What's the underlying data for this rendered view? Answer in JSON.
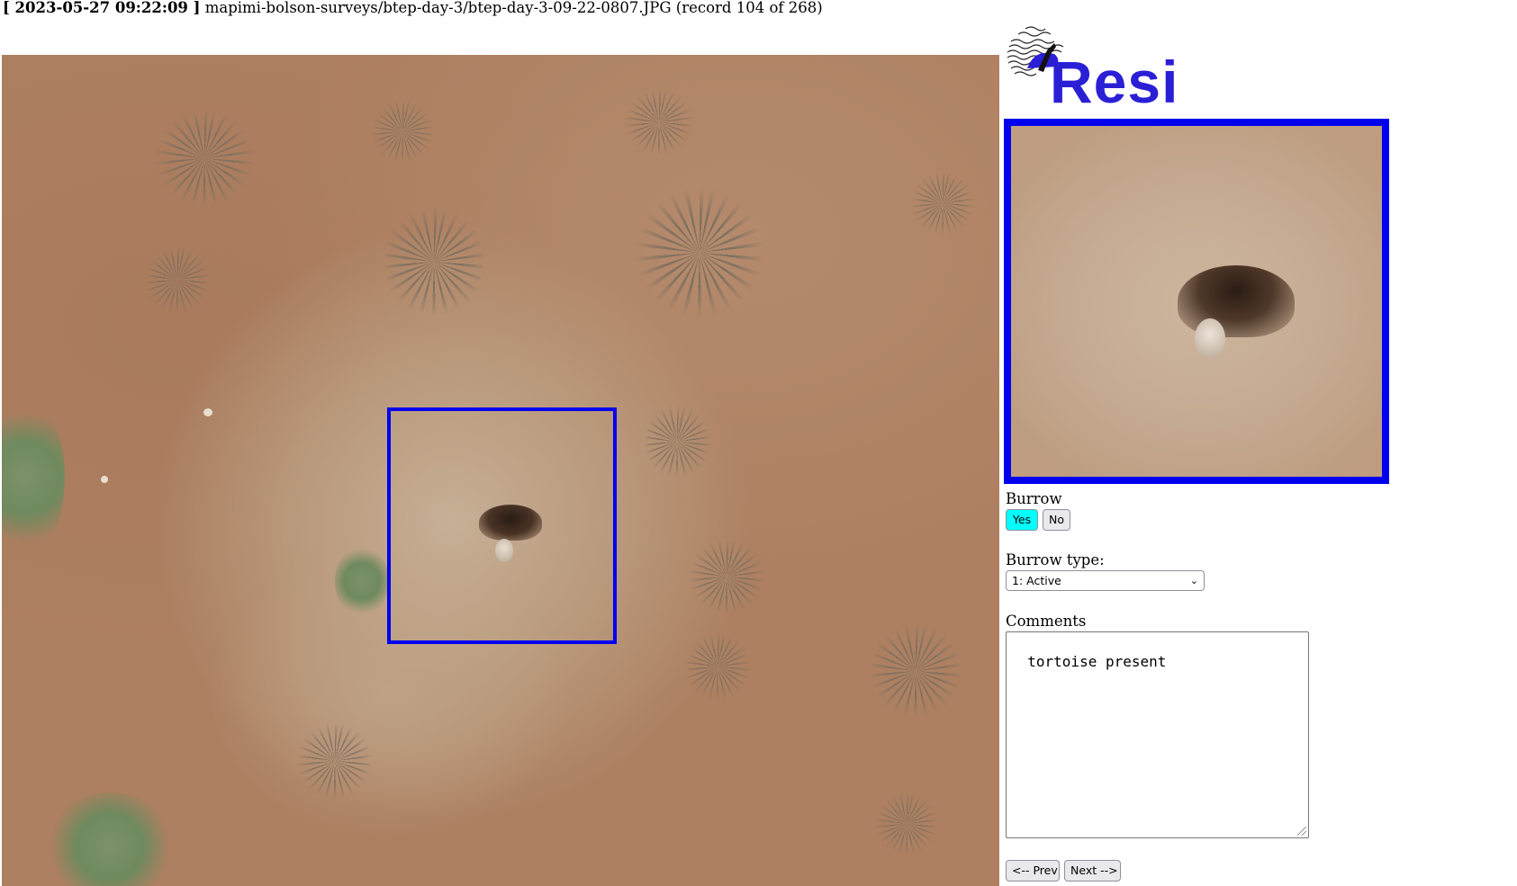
{
  "header": {
    "timestamp": "[ 2023-05-27 09:22:09 ]",
    "file_path": "mapimi-bolson-surveys/btep-day-3/btep-day-3-09-22-0807.JPG",
    "record_info": "(record 104 of 268)"
  },
  "logo": {
    "text": "Resi",
    "color": "#2b1fd6"
  },
  "colors": {
    "bbox": "#0000ee",
    "active_button": "#00ffff"
  },
  "burrow": {
    "label": "Burrow",
    "yes_label": "Yes",
    "no_label": "No",
    "selected": "Yes"
  },
  "burrow_type": {
    "label": "Burrow type:",
    "selected": "1: Active"
  },
  "comments": {
    "label": "Comments",
    "value": "tortoise present"
  },
  "nav": {
    "prev_label": "<-- Prev",
    "next_label": "Next -->"
  },
  "icons": [
    "resi-logo-icon",
    "tortoise-icon",
    "chevron-down-icon",
    "resize-grip-icon"
  ]
}
